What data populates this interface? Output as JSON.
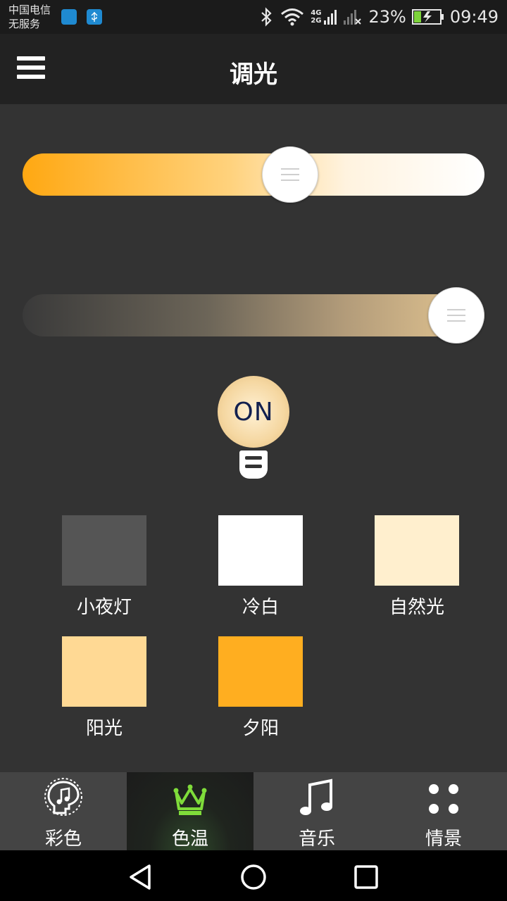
{
  "status_bar": {
    "carrier_line1": "中国电信",
    "carrier_line2": "无服务",
    "network_label_top": "4G",
    "network_label_bottom": "2G",
    "battery_percent": "23%",
    "time": "09:49"
  },
  "header": {
    "title": "调光"
  },
  "sliders": {
    "brightness_level": 0.58,
    "temperature_level": 0.94
  },
  "power_button": {
    "label": "ON"
  },
  "presets": [
    {
      "label": "小夜灯",
      "color": "#555555"
    },
    {
      "label": "冷白",
      "color": "#ffffff"
    },
    {
      "label": "自然光",
      "color": "#ffefce"
    },
    {
      "label": "阳光",
      "color": "#ffd994"
    },
    {
      "label": "夕阳",
      "color": "#ffae20"
    }
  ],
  "tabs": [
    {
      "label": "彩色",
      "icon": "music-bulb-icon"
    },
    {
      "label": "色温",
      "icon": "crown-icon",
      "active": true
    },
    {
      "label": "音乐",
      "icon": "music-note-icon"
    },
    {
      "label": "情景",
      "icon": "four-dots-icon"
    }
  ],
  "colors": {
    "accent_active_tab": "#7fdc3a",
    "background": "#333333",
    "appbar": "#222222"
  }
}
